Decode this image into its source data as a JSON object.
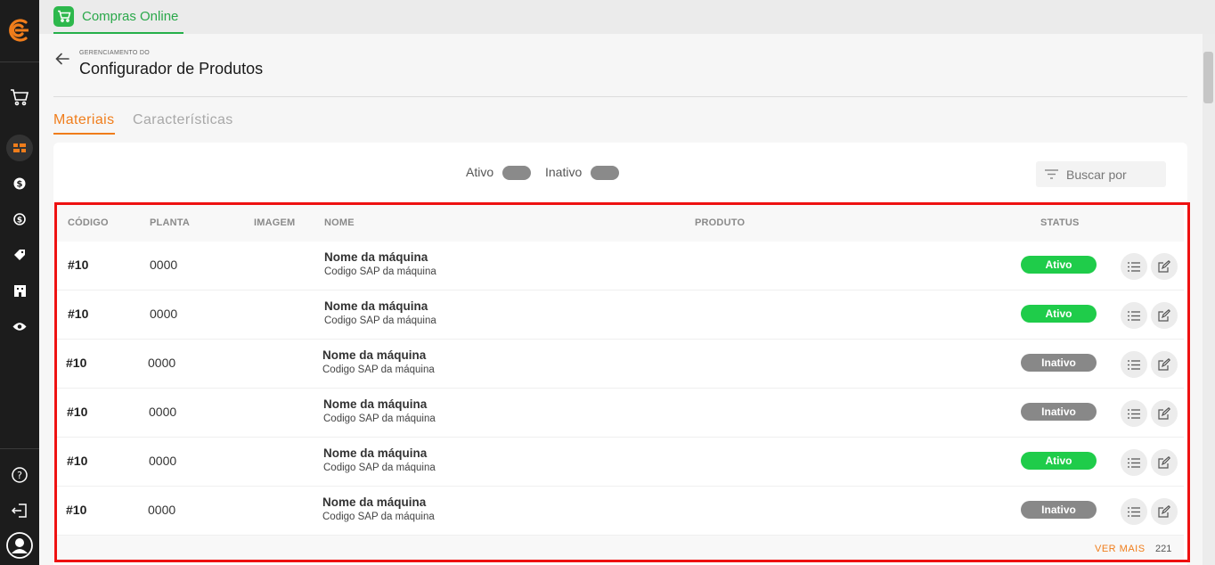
{
  "app": {
    "title": "Compras Online",
    "accent": "#2aa84a"
  },
  "header": {
    "breadcrumb": "GERENCIAMENTO DO",
    "title": "Configurador de Produtos"
  },
  "tabs": [
    {
      "label": "Materiais",
      "active": true
    },
    {
      "label": "Características",
      "active": false
    }
  ],
  "filters": {
    "active_label": "Ativo",
    "inactive_label": "Inativo",
    "search_placeholder": "Buscar por"
  },
  "table": {
    "headers": {
      "code": "CÓDIGO",
      "plant": "PLANTA",
      "image": "IMAGEM",
      "name": "NOME",
      "product": "PRODUTO",
      "status": "STATUS"
    },
    "rows": [
      {
        "code": "#10",
        "plant": "0000",
        "name": "Nome da máquina",
        "sub": "Codigo SAP da máquina",
        "status": "Ativo"
      },
      {
        "code": "#10",
        "plant": "0000",
        "name": "Nome da máquina",
        "sub": "Codigo SAP da máquina",
        "status": "Ativo"
      },
      {
        "code": "#10",
        "plant": "0000",
        "name": "Nome da máquina",
        "sub": "Codigo SAP da máquina",
        "status": "Inativo"
      },
      {
        "code": "#10",
        "plant": "0000",
        "name": "Nome da máquina",
        "sub": "Codigo SAP da máquina",
        "status": "Inativo"
      },
      {
        "code": "#10",
        "plant": "0000",
        "name": "Nome da máquina",
        "sub": "Codigo SAP da máquina",
        "status": "Ativo"
      },
      {
        "code": "#10",
        "plant": "0000",
        "name": "Nome da máquina",
        "sub": "Codigo SAP da máquina",
        "status": "Inativo"
      }
    ],
    "footer": {
      "more_label": "VER MAIS",
      "count": "221"
    }
  },
  "colors": {
    "orange": "#f07d1b",
    "active_badge": "#1fcc4a",
    "inactive_badge": "#888888",
    "highlight": "#ee1111"
  },
  "sidebar_icons": [
    "logo-icon",
    "cart-icon",
    "products-icon",
    "dollar-icon",
    "exchange-icon",
    "tag-icon",
    "building-icon",
    "eye-icon",
    "help-icon",
    "logout-icon",
    "user-avatar-icon"
  ]
}
